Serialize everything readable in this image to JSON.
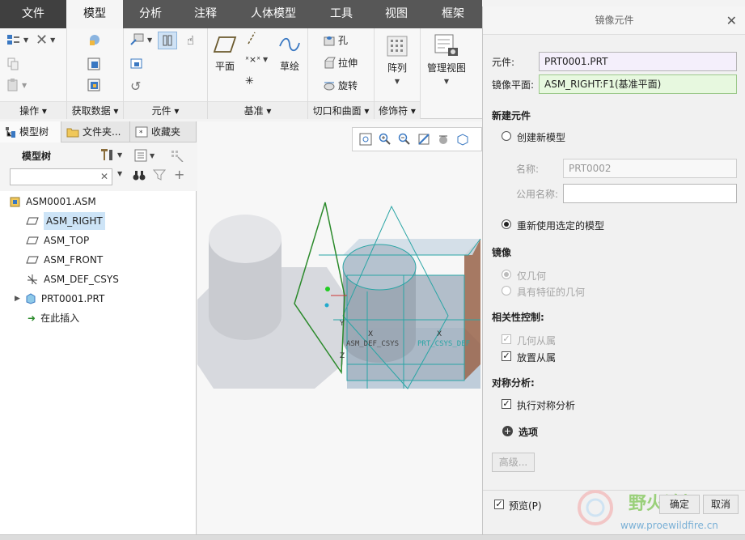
{
  "tabs": [
    "文件",
    "模型",
    "分析",
    "注释",
    "人体模型",
    "工具",
    "视图",
    "框架"
  ],
  "ribbon": {
    "groups": {
      "operations": "操作",
      "get_data": "获取数据",
      "components": "元件",
      "datum": "基准",
      "cut_surface": "切口和曲面",
      "modifiers": "修饰符"
    },
    "plane": "平面",
    "sketch": "草绘",
    "hole": "孔",
    "extrude": "拉伸",
    "revolve": "旋转",
    "pattern": "阵列",
    "manage_views": "管理视图"
  },
  "left_tabs": [
    "模型树",
    "文件夹...",
    "收藏夹"
  ],
  "model_tree": {
    "title": "模型树",
    "items": [
      {
        "label": "ASM0001.ASM"
      },
      {
        "label": "ASM_RIGHT"
      },
      {
        "label": "ASM_TOP"
      },
      {
        "label": "ASM_FRONT"
      },
      {
        "label": "ASM_DEF_CSYS"
      },
      {
        "label": "PRT0001.PRT"
      },
      {
        "label": "在此插入"
      }
    ]
  },
  "viewport": {
    "labels": {
      "csys": "ASM_DEF_CSYS",
      "prt": "PRT_CSYS_DEF",
      "y": "Y",
      "x": "X",
      "z": "Z"
    }
  },
  "dialog": {
    "title": "镜像元件",
    "component_label": "元件:",
    "component_value": "PRT0001.PRT",
    "plane_label": "镜像平面:",
    "plane_value": "ASM_RIGHT:F1(基准平面)",
    "new_comp_section": "新建元件",
    "create_new": "创建新模型",
    "name_label": "名称:",
    "name_value": "PRT0002",
    "common_name_label": "公用名称:",
    "reuse": "重新使用选定的模型",
    "mirror_section": "镜像",
    "geom_only": "仅几何",
    "geom_features": "具有特征的几何",
    "dependency_section": "相关性控制:",
    "geom_dep": "几何从属",
    "place_dep": "放置从属",
    "symmetry_section": "对称分析:",
    "run_symmetry": "执行对称分析",
    "options": "选项",
    "advanced": "高级...",
    "preview": "预览(P)",
    "ok": "确定",
    "cancel": "取消"
  },
  "watermark": {
    "text": "野火论坛",
    "url": "www.proewildfire.cn"
  }
}
